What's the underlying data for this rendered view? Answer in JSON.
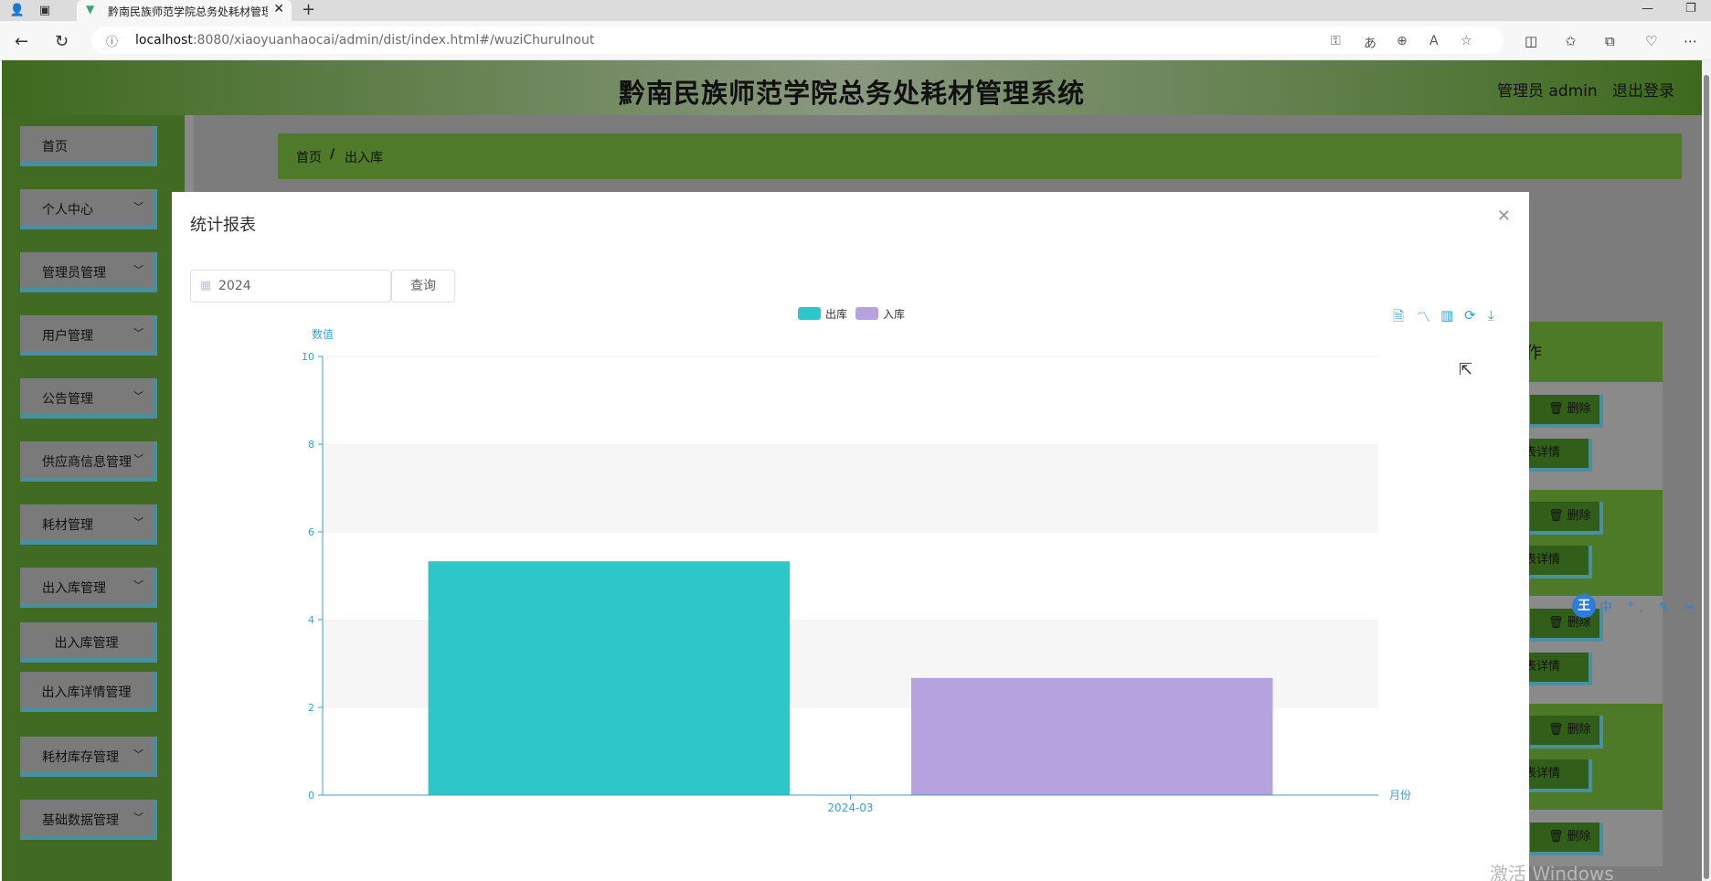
{
  "browser": {
    "tab_title": "黔南民族师范学院总务处耗材管理系统",
    "url_host": "localhost",
    "url_path": ":8080/xiaoyuanhaocai/admin/dist/index.html#/wuziChuruInout"
  },
  "header": {
    "title": "黔南民族师范学院总务处耗材管理系统",
    "user": "管理员 admin",
    "logout": "退出登录"
  },
  "sidebar": {
    "items": [
      {
        "label": "首页"
      },
      {
        "label": "个人中心"
      },
      {
        "label": "管理员管理"
      },
      {
        "label": "用户管理"
      },
      {
        "label": "公告管理"
      },
      {
        "label": "供应商信息管理"
      },
      {
        "label": "耗材管理"
      },
      {
        "label": "出入库管理"
      },
      {
        "label": "出入库管理"
      },
      {
        "label": "出入库详情管理"
      },
      {
        "label": "耗材库存管理"
      },
      {
        "label": "基础数据管理"
      }
    ]
  },
  "breadcrumb": {
    "home": "首页",
    "separator": "/",
    "current": "出入库"
  },
  "background": {
    "column_header": "作",
    "delete_label": "删除",
    "detail_label": "表详情"
  },
  "modal": {
    "title": "统计报表",
    "year_value": "2024",
    "query_label": "查询"
  },
  "chart_data": {
    "type": "bar",
    "categories": [
      "2024-03"
    ],
    "series": [
      {
        "name": "出库",
        "values": [
          5.33
        ],
        "color": "#2ec7c9"
      },
      {
        "name": "入库",
        "values": [
          2.67
        ],
        "color": "#b6a2de"
      }
    ],
    "ylabel": "数值",
    "xlabel": "月份",
    "ylim": [
      0,
      10
    ],
    "yticks": [
      "0",
      "2",
      "4",
      "6",
      "8",
      "10"
    ],
    "legend": "top-center",
    "grid": "alternating-bands"
  },
  "overlay": {
    "watermark": "激活 Windows",
    "ime_logo": "王",
    "ime_items": "中 °, ✎ ✂ ⌨"
  }
}
